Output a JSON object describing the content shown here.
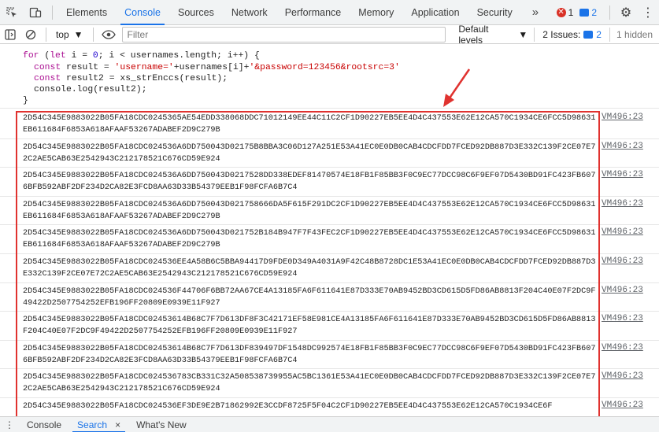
{
  "tabbar": {
    "tabs": [
      "Elements",
      "Console",
      "Sources",
      "Network",
      "Performance",
      "Memory",
      "Application",
      "Security"
    ],
    "active_tab": "Console",
    "more_label": "»",
    "error_count": "1",
    "issue_count": "2"
  },
  "toolbar": {
    "context": "top",
    "filter_placeholder": "Filter",
    "levels_label": "Default levels",
    "issues_label": "2 Issues:",
    "issues_count": "2",
    "hidden_label": "1 hidden"
  },
  "code": {
    "line1_kw": "for",
    "line1_a": " (",
    "line1_let": "let",
    "line1_b": " i = ",
    "line1_zero": "0",
    "line1_c": "; i < usernames.length; i++) {",
    "line2_const": "const",
    "line2_a": " result = ",
    "line2_str1": "'username='",
    "line2_b": "+usernames[i]+",
    "line2_str2": "'&password=123456&rootsrc=3'",
    "line3_const": "const",
    "line3_a": " result2 = xs_strEnccs(result);",
    "line4": "console.log(result2);",
    "line5": "}"
  },
  "messages": [
    {
      "text": "2D54C345E9883022B05FA18CDC0245365AE54EDD338068DDC71012149EE44C11C2CF1D90227EB5EE4D4C437553E62E12CA570C1934CE6FCC5D98631EB611684F6853A618AFAAF53267ADABEF2D9C279B",
      "src": "VM496:23"
    },
    {
      "text": "2D54C345E9883022B05FA18CDC024536A6DD750043D02175B8BBA3C06D127A251E53A41EC0E0DB0CAB4CDCFDD7FCED92DB887D3E332C139F2CE07E72C2AE5CAB63E2542943C212178521C676CD59E924",
      "src": "VM496:23"
    },
    {
      "text": "2D54C345E9883022B05FA18CDC024536A6DD750043D0217528DD338EDEF81470574E18FB1F85BB3F0C9EC77DCC98C6F9EF07D5430BD91FC423FB6076BFB592ABF2DF234D2CA82E3FCD8AA63D33B54379EEB1F98FCFA6B7C4",
      "src": "VM496:23"
    },
    {
      "text": "2D54C345E9883022B05FA18CDC024536A6DD750043D021758666DA5F615F291DC2CF1D90227EB5EE4D4C437553E62E12CA570C1934CE6FCC5D98631EB611684F6853A618AFAAF53267ADABEF2D9C279B",
      "src": "VM496:23"
    },
    {
      "text": "2D54C345E9883022B05FA18CDC024536A6DD750043D021752B184B947F7F43FEC2CF1D90227EB5EE4D4C437553E62E12CA570C1934CE6FCC5D98631EB611684F6853A618AFAAF53267ADABEF2D9C279B",
      "src": "VM496:23"
    },
    {
      "text": "2D54C345E9883022B05FA18CDC024536EE4A58B6C5BBA94417D9FDE0D349A4031A9F42C48B8728DC1E53A41EC0E0DB0CAB4CDCFDD7FCED92DB887D3E332C139F2CE07E72C2AE5CAB63E2542943C212178521C676CD59E924",
      "src": "VM496:23"
    },
    {
      "text": "2D54C345E9883022B05FA18CDC024536F44706F6BB72AA67CE4A13185FA6F611641E87D333E70AB9452BD3CD615D5FD86AB8813F204C40E07F2DC9F49422D2507754252EFB196FF20809E0939E11F927",
      "src": "VM496:23"
    },
    {
      "text": "2D54C345E9883022B05FA18CDC02453614B68C7F7D613DF8F3C42171EF58E981CE4A13185FA6F611641E87D333E70AB9452BD3CD615D5FD86AB8813F204C40E07F2DC9F49422D2507754252EFB196FF20809E0939E11F927",
      "src": "VM496:23"
    },
    {
      "text": "2D54C345E9883022B05FA18CDC02453614B68C7F7D613DF839497DF1548DC992574E18FB1F85BB3F0C9EC77DCC98C6F9EF07D5430BD91FC423FB6076BFB592ABF2DF234D2CA82E3FCD8AA63D33B54379EEB1F98FCFA6B7C4",
      "src": "VM496:23"
    },
    {
      "text": "2D54C345E9883022B05FA18CDC024536783CB331C32A508538739955AC5BC1361E53A41EC0E0DB0CAB4CDCFDD7FCED92DB887D3E332C139F2CE07E72C2AE5CAB63E2542943C212178521C676CD59E924",
      "src": "VM496:23"
    },
    {
      "text": "2D54C345E9883022B05FA18CDC024536EF3DE9E2B71862992E3CCDF8725F5F04C2CF1D90227EB5EE4D4C437553E62E12CA570C1934CE6F",
      "src": "VM496:23"
    }
  ],
  "drawer": {
    "tabs": [
      "Console",
      "Search",
      "What's New"
    ],
    "active_tab": "Search",
    "close": "×"
  },
  "colors": {
    "accent": "#1a73e8",
    "highlight_box": "#e0322f",
    "error": "#d93025"
  }
}
